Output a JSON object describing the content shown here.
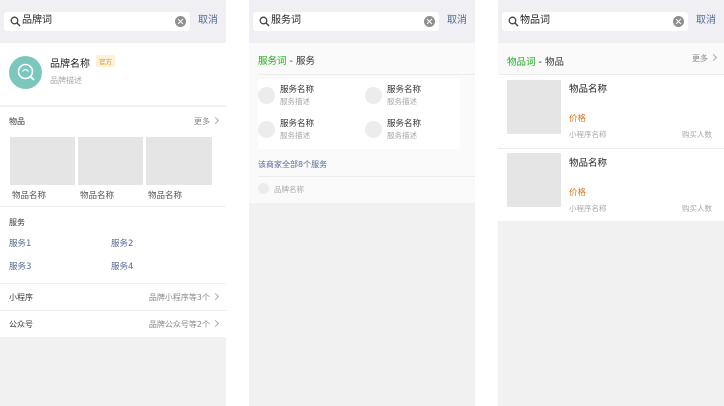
{
  "colors": {
    "link": "#576b95",
    "green": "#1aad19",
    "price": "#d9771b",
    "brand_logo": "#7cc6c0"
  },
  "screens": [
    {
      "search": {
        "query": "品牌词",
        "cancel": "取消"
      },
      "brand": {
        "name": "品牌名称",
        "badge": "官方",
        "desc": "品牌描述",
        "logo_icon": "magnifier-logo-icon"
      },
      "items": {
        "title": "物品",
        "more": "更多",
        "names": [
          "物品名称",
          "物品名称",
          "物品名称"
        ]
      },
      "services": {
        "title": "服务",
        "links": [
          "服务1",
          "服务2",
          "服务3",
          "服务4"
        ]
      },
      "miniprogram": {
        "title": "小程序",
        "value": "品牌小程序等3个"
      },
      "official": {
        "title": "公众号",
        "value": "品牌公众号等2个"
      }
    },
    {
      "search": {
        "query": "服务词",
        "cancel": "取消"
      },
      "header": {
        "keyword": "服务词",
        "sep": " - ",
        "category": "服务"
      },
      "services": [
        {
          "name": "服务名称",
          "desc": "服务描述"
        },
        {
          "name": "服务名称",
          "desc": "服务描述"
        },
        {
          "name": "服务名称",
          "desc": "服务描述"
        },
        {
          "name": "服务名称",
          "desc": "服务描述"
        }
      ],
      "all_link": "该商家全部8个服务",
      "brand_row": "品牌名称"
    },
    {
      "search": {
        "query": "物品词",
        "cancel": "取消"
      },
      "header": {
        "keyword": "物品词",
        "sep": " - ",
        "category": "物品",
        "more": "更多"
      },
      "products": [
        {
          "name": "物品名称",
          "price": "价格",
          "mini": "小程序名称",
          "buyers": "购买人数"
        },
        {
          "name": "物品名称",
          "price": "价格",
          "mini": "小程序名称",
          "buyers": "购买人数"
        }
      ]
    }
  ]
}
